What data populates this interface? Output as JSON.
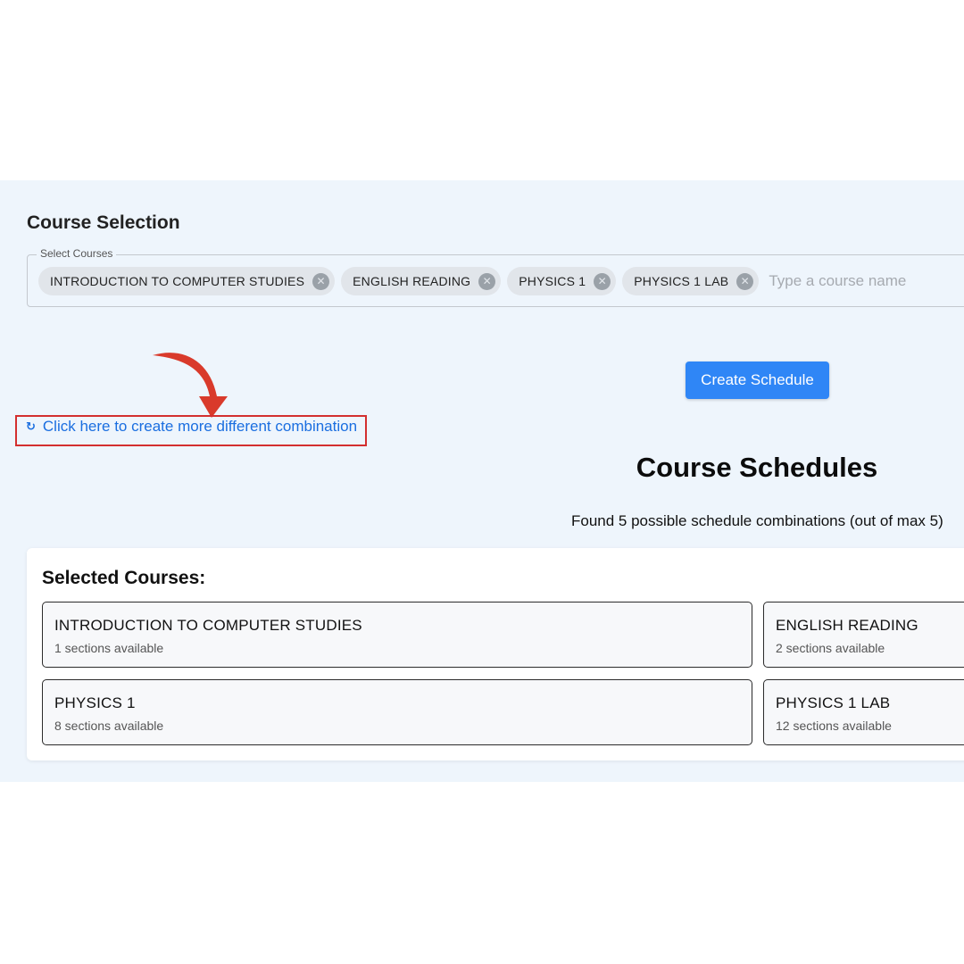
{
  "course_selection": {
    "title": "Course Selection",
    "select_label": "Select Courses",
    "chips": [
      {
        "label": "INTRODUCTION TO COMPUTER STUDIES"
      },
      {
        "label": "ENGLISH READING"
      },
      {
        "label": "PHYSICS 1"
      },
      {
        "label": "PHYSICS 1 LAB"
      }
    ],
    "input_placeholder": "Type a course name"
  },
  "actions": {
    "create_schedule_label": "Create Schedule",
    "combination_link_label": "Click here to create more different combination",
    "refresh_glyph": "↻"
  },
  "schedules": {
    "title": "Course Schedules",
    "found_text": "Found 5 possible schedule combinations (out of max 5)"
  },
  "selected_courses": {
    "title": "Selected Courses:",
    "items": [
      {
        "name": "INTRODUCTION TO COMPUTER STUDIES",
        "sections": "1 sections available"
      },
      {
        "name": "ENGLISH READING",
        "sections": "2 sections available"
      },
      {
        "name": "PHYSICS 1",
        "sections": "8 sections available"
      },
      {
        "name": "PHYSICS 1 LAB",
        "sections": "12 sections available"
      }
    ]
  },
  "colors": {
    "panel_background": "#eef5fc",
    "primary_button": "#2f86f6",
    "link": "#1a6ee0",
    "annotation_red": "#d32f2f"
  },
  "icons": {
    "chip_delete": "cancel-circle-icon",
    "annotation": "curved-arrow-down-icon"
  }
}
